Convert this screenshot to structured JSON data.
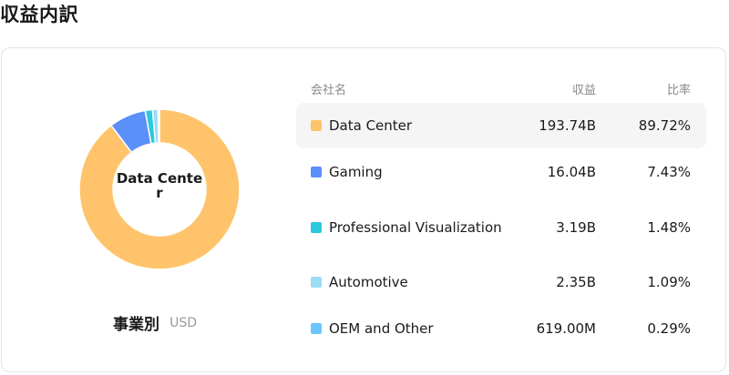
{
  "page_title": "収益内訳",
  "caption": {
    "title": "事業別",
    "unit": "USD"
  },
  "table": {
    "headers": {
      "name": "会社名",
      "revenue": "収益",
      "ratio": "比率"
    },
    "rows": [
      {
        "name": "Data Center",
        "revenue": "193.74B",
        "ratio": "89.72%",
        "color": "#FFC46B"
      },
      {
        "name": "Gaming",
        "revenue": "16.04B",
        "ratio": "7.43%",
        "color": "#5B8FF9"
      },
      {
        "name": "Professional Visualization",
        "revenue": "3.19B",
        "ratio": "1.48%",
        "color": "#2BC8E0"
      },
      {
        "name": "Automotive",
        "revenue": "2.35B",
        "ratio": "1.09%",
        "color": "#9ADDF5"
      },
      {
        "name": "OEM and Other",
        "revenue": "619.00M",
        "ratio": "0.29%",
        "color": "#6CC6FF"
      }
    ],
    "active_index": 0
  },
  "chart_data": {
    "type": "pie",
    "center_label": "Data Center",
    "categories": [
      "Data Center",
      "Gaming",
      "Professional Visualization",
      "Automotive",
      "OEM and Other"
    ],
    "values": [
      89.72,
      7.43,
      1.48,
      1.09,
      0.29
    ],
    "colors": [
      "#FFC46B",
      "#5B8FF9",
      "#2BC8E0",
      "#9ADDF5",
      "#6CC6FF"
    ],
    "legend": "right"
  }
}
